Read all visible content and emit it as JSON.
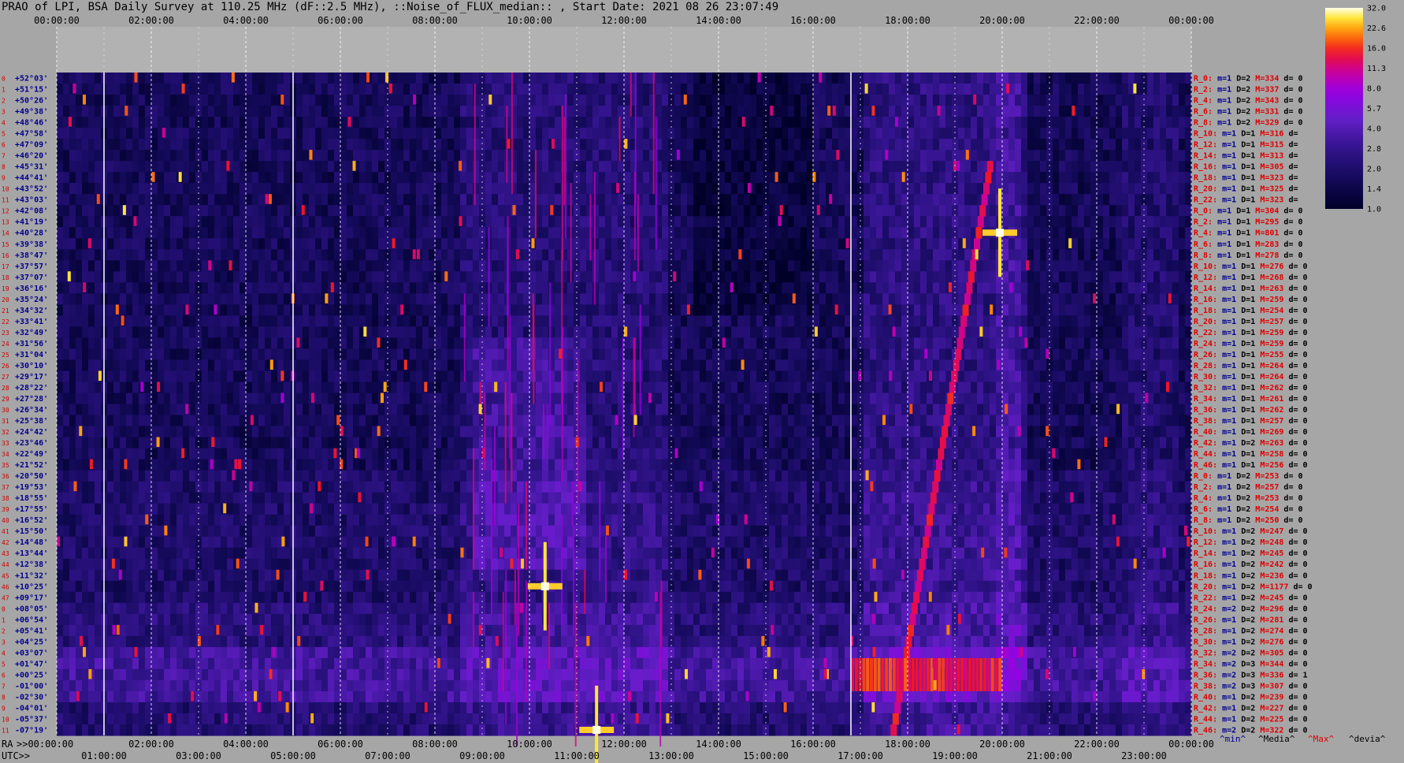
{
  "title": "PRAO of LPI, BSA Daily Survey at 110.25 MHz (dF::2.5 MHz), ::Noise_of_FLUX_median:: , Start Date: 2021 08 26 23:07:49",
  "colors": {
    "background": "#a6a6a6",
    "label_red": "#e00000",
    "label_blue": "#000090"
  },
  "chart_data": {
    "type": "heatmap",
    "x_top_ticks": [
      "00:00:00",
      "02:00:00",
      "04:00:00",
      "06:00:00",
      "08:00:00",
      "10:00:00",
      "12:00:00",
      "14:00:00",
      "16:00:00",
      "18:00:00",
      "20:00:00",
      "22:00:00",
      "00:00:00"
    ],
    "x_ra_ticks": [
      ">>00:00:00",
      "02:00:00",
      "04:00:00",
      "06:00:00",
      "08:00:00",
      "10:00:00",
      "12:00:00",
      "14:00:00",
      "16:00:00",
      "18:00:00",
      "20:00:00",
      "22:00:00",
      "00:00:00"
    ],
    "x_utc_ticks": [
      "01:00:00",
      "03:00:00",
      "05:00:00",
      "07:00:00",
      "09:00:00",
      "11:00:00",
      "13:00:00",
      "15:00:00",
      "17:00:00",
      "19:00:00",
      "21:00:00",
      "23:00:00"
    ],
    "x_ra_label": "RA",
    "x_utc_label": "UTC>>",
    "y_declinations": [
      "+52°03'",
      "+51°15'",
      "+50°26'",
      "+49°38'",
      "+48°46'",
      "+47°58'",
      "+47°09'",
      "+46°20'",
      "+45°31'",
      "+44°41'",
      "+43°52'",
      "+43°03'",
      "+42°08'",
      "+41°19'",
      "+40°28'",
      "+39°38'",
      "+38°47'",
      "+37°57'",
      "+37°07'",
      "+36°16'",
      "+35°24'",
      "+34°32'",
      "+33°41'",
      "+32°49'",
      "+31°56'",
      "+31°04'",
      "+30°10'",
      "+29°17'",
      "+28°22'",
      "+27°28'",
      "+26°34'",
      "+25°38'",
      "+24°42'",
      "+23°46'",
      "+22°49'",
      "+21°52'",
      "+20°50'",
      "+19°53'",
      "+18°55'",
      "+17°55'",
      "+16°52'",
      "+15°50'",
      "+14°48'",
      "+13°44'",
      "+12°38'",
      "+11°32'",
      "+10°25'",
      "+09°17'",
      "+08°05'",
      "+06°54'",
      "+05°41'",
      "+04°25'",
      "+03°07'",
      "+01°47'",
      "+00°25'",
      "-01°00'",
      "-02°30'",
      "-04°01'",
      "-05°37'",
      "-07°19'"
    ],
    "row_index": [
      "0",
      "1",
      "2",
      "3",
      "4",
      "5",
      "6",
      "7",
      "8",
      "9",
      "10",
      "11",
      "12",
      "13",
      "14",
      "15",
      "16",
      "17",
      "18",
      "19",
      "20",
      "21",
      "22",
      "23",
      "24",
      "25",
      "26",
      "27",
      "28",
      "29",
      "30",
      "31",
      "32",
      "33",
      "34",
      "35",
      "36",
      "37",
      "38",
      "39",
      "40",
      "41",
      "42",
      "43",
      "44",
      "45",
      "46",
      "47"
    ],
    "right_stats": [
      {
        "r": "R_0:",
        "m": "m=1",
        "d": "D=2",
        "M": "M=334",
        "dev": "d= 0"
      },
      {
        "r": "R_2:",
        "m": "m=1",
        "d": "D=2",
        "M": "M=337",
        "dev": "d= 0"
      },
      {
        "r": "R_4:",
        "m": "m=1",
        "d": "D=2",
        "M": "M=343",
        "dev": "d= 0"
      },
      {
        "r": "R_6:",
        "m": "m=1",
        "d": "D=2",
        "M": "M=331",
        "dev": "d= 0"
      },
      {
        "r": "R_8:",
        "m": "m=1",
        "d": "D=2",
        "M": "M=329",
        "dev": "d= 0"
      },
      {
        "r": "R_10:",
        "m": "m=1",
        "d": "D=1",
        "M": "M=316",
        "dev": "d="
      },
      {
        "r": "R_12:",
        "m": "m=1",
        "d": "D=1",
        "M": "M=315",
        "dev": "d="
      },
      {
        "r": "R_14:",
        "m": "m=1",
        "d": "D=1",
        "M": "M=313",
        "dev": "d="
      },
      {
        "r": "R_16:",
        "m": "m=1",
        "d": "D=1",
        "M": "M=305",
        "dev": "d="
      },
      {
        "r": "R_18:",
        "m": "m=1",
        "d": "D=1",
        "M": "M=323",
        "dev": "d="
      },
      {
        "r": "R_20:",
        "m": "m=1",
        "d": "D=1",
        "M": "M=325",
        "dev": "d="
      },
      {
        "r": "R_22:",
        "m": "m=1",
        "d": "D=1",
        "M": "M=323",
        "dev": "d="
      },
      {
        "r": "R_0:",
        "m": "m=1",
        "d": "D=1",
        "M": "M=304",
        "dev": "d= 0"
      },
      {
        "r": "R_2:",
        "m": "m=1",
        "d": "D=1",
        "M": "M=295",
        "dev": "d= 0"
      },
      {
        "r": "R_4:",
        "m": "m=1",
        "d": "D=1",
        "M": "M=801",
        "dev": "d= 0"
      },
      {
        "r": "R_6:",
        "m": "m=1",
        "d": "D=1",
        "M": "M=283",
        "dev": "d= 0"
      },
      {
        "r": "R_8:",
        "m": "m=1",
        "d": "D=1",
        "M": "M=278",
        "dev": "d= 0"
      },
      {
        "r": "R_10:",
        "m": "m=1",
        "d": "D=1",
        "M": "M=276",
        "dev": "d= 0"
      },
      {
        "r": "R_12:",
        "m": "m=1",
        "d": "D=1",
        "M": "M=268",
        "dev": "d= 0"
      },
      {
        "r": "R_14:",
        "m": "m=1",
        "d": "D=1",
        "M": "M=263",
        "dev": "d= 0"
      },
      {
        "r": "R_16:",
        "m": "m=1",
        "d": "D=1",
        "M": "M=259",
        "dev": "d= 0"
      },
      {
        "r": "R_18:",
        "m": "m=1",
        "d": "D=1",
        "M": "M=254",
        "dev": "d= 0"
      },
      {
        "r": "R_20:",
        "m": "m=1",
        "d": "D=1",
        "M": "M=257",
        "dev": "d= 0"
      },
      {
        "r": "R_22:",
        "m": "m=1",
        "d": "D=1",
        "M": "M=259",
        "dev": "d= 0"
      },
      {
        "r": "R_24:",
        "m": "m=1",
        "d": "D=1",
        "M": "M=259",
        "dev": "d= 0"
      },
      {
        "r": "R_26:",
        "m": "m=1",
        "d": "D=1",
        "M": "M=255",
        "dev": "d= 0"
      },
      {
        "r": "R_28:",
        "m": "m=1",
        "d": "D=1",
        "M": "M=264",
        "dev": "d= 0"
      },
      {
        "r": "R_30:",
        "m": "m=1",
        "d": "D=1",
        "M": "M=264",
        "dev": "d= 0"
      },
      {
        "r": "R_32:",
        "m": "m=1",
        "d": "D=1",
        "M": "M=262",
        "dev": "d= 0"
      },
      {
        "r": "R_34:",
        "m": "m=1",
        "d": "D=1",
        "M": "M=261",
        "dev": "d= 0"
      },
      {
        "r": "R_36:",
        "m": "m=1",
        "d": "D=1",
        "M": "M=262",
        "dev": "d= 0"
      },
      {
        "r": "R_38:",
        "m": "m=1",
        "d": "D=1",
        "M": "M=257",
        "dev": "d= 0"
      },
      {
        "r": "R_40:",
        "m": "m=1",
        "d": "D=1",
        "M": "M=269",
        "dev": "d= 0"
      },
      {
        "r": "R_42:",
        "m": "m=1",
        "d": "D=2",
        "M": "M=263",
        "dev": "d= 0"
      },
      {
        "r": "R_44:",
        "m": "m=1",
        "d": "D=1",
        "M": "M=258",
        "dev": "d= 0"
      },
      {
        "r": "R_46:",
        "m": "m=1",
        "d": "D=1",
        "M": "M=256",
        "dev": "d= 0"
      },
      {
        "r": "R_0:",
        "m": "m=1",
        "d": "D=2",
        "M": "M=253",
        "dev": "d= 0"
      },
      {
        "r": "R_2:",
        "m": "m=1",
        "d": "D=2",
        "M": "M=257",
        "dev": "d= 0"
      },
      {
        "r": "R_4:",
        "m": "m=1",
        "d": "D=2",
        "M": "M=253",
        "dev": "d= 0"
      },
      {
        "r": "R_6:",
        "m": "m=1",
        "d": "D=2",
        "M": "M=254",
        "dev": "d= 0"
      },
      {
        "r": "R_8:",
        "m": "m=1",
        "d": "D=2",
        "M": "M=250",
        "dev": "d= 0"
      },
      {
        "r": "R_10:",
        "m": "m=1",
        "d": "D=2",
        "M": "M=247",
        "dev": "d= 0"
      },
      {
        "r": "R_12:",
        "m": "m=1",
        "d": "D=2",
        "M": "M=248",
        "dev": "d= 0"
      },
      {
        "r": "R_14:",
        "m": "m=1",
        "d": "D=2",
        "M": "M=245",
        "dev": "d= 0"
      },
      {
        "r": "R_16:",
        "m": "m=1",
        "d": "D=2",
        "M": "M=242",
        "dev": "d= 0"
      },
      {
        "r": "R_18:",
        "m": "m=1",
        "d": "D=2",
        "M": "M=236",
        "dev": "d= 0"
      },
      {
        "r": "R_20:",
        "m": "m=1",
        "d": "D=2",
        "M": "M=1177",
        "dev": "d= 0"
      },
      {
        "r": "R_22:",
        "m": "m=1",
        "d": "D=2",
        "M": "M=245",
        "dev": "d= 0"
      },
      {
        "r": "R_24:",
        "m": "m=2",
        "d": "D=2",
        "M": "M=296",
        "dev": "d= 0"
      },
      {
        "r": "R_26:",
        "m": "m=1",
        "d": "D=2",
        "M": "M=281",
        "dev": "d= 0"
      },
      {
        "r": "R_28:",
        "m": "m=1",
        "d": "D=2",
        "M": "M=274",
        "dev": "d= 0"
      },
      {
        "r": "R_30:",
        "m": "m=1",
        "d": "D=2",
        "M": "M=276",
        "dev": "d= 0"
      },
      {
        "r": "R_32:",
        "m": "m=2",
        "d": "D=2",
        "M": "M=305",
        "dev": "d= 0"
      },
      {
        "r": "R_34:",
        "m": "m=2",
        "d": "D=3",
        "M": "M=344",
        "dev": "d= 0"
      },
      {
        "r": "R_36:",
        "m": "m=2",
        "d": "D=3",
        "M": "M=336",
        "dev": "d= 1"
      },
      {
        "r": "R_38:",
        "m": "m=2",
        "d": "D=3",
        "M": "M=307",
        "dev": "d= 0"
      },
      {
        "r": "R_40:",
        "m": "m=1",
        "d": "D=2",
        "M": "M=239",
        "dev": "d= 0"
      },
      {
        "r": "R_42:",
        "m": "m=1",
        "d": "D=2",
        "M": "M=227",
        "dev": "d= 0"
      },
      {
        "r": "R_44:",
        "m": "m=1",
        "d": "D=2",
        "M": "M=225",
        "dev": "d= 0"
      },
      {
        "r": "R_46:",
        "m": "m=2",
        "d": "D=2",
        "M": "M=322",
        "dev": "d= 0"
      }
    ],
    "legend": [
      "^min^",
      "^Media^",
      "^Max^",
      "^devia^"
    ],
    "colorbar": {
      "ticks": [
        "32.0",
        "22.6",
        "16.0",
        "11.3",
        "8.0",
        "5.7",
        "4.0",
        "2.8",
        "2.0",
        "1.4",
        "1.0"
      ],
      "scale": "log"
    },
    "bright_sources": [
      {
        "time_h": 10.33,
        "row": 46,
        "intensity": 32
      },
      {
        "time_h": 19.95,
        "row": 14,
        "intensity": 32
      },
      {
        "time_h": 11.42,
        "row": 59,
        "intensity": 28
      }
    ]
  }
}
